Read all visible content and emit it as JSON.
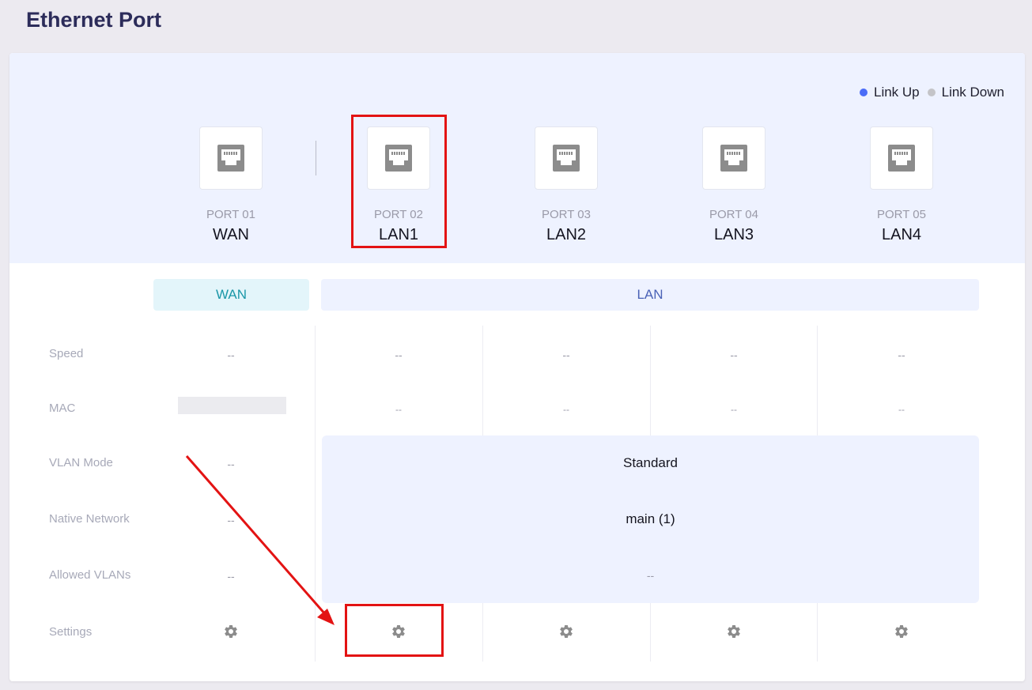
{
  "page": {
    "title": "Ethernet Port"
  },
  "legend": {
    "link_up": "Link Up",
    "link_down": "Link Down",
    "link_up_color": "#4a6cf7",
    "link_down_color": "#c4c4c8"
  },
  "ports": [
    {
      "num": "PORT 01",
      "name": "WAN"
    },
    {
      "num": "PORT 02",
      "name": "LAN1"
    },
    {
      "num": "PORT 03",
      "name": "LAN2"
    },
    {
      "num": "PORT 04",
      "name": "LAN3"
    },
    {
      "num": "PORT 05",
      "name": "LAN4"
    }
  ],
  "groups": {
    "wan": "WAN",
    "lan": "LAN"
  },
  "rows": {
    "speed": "Speed",
    "mac": "MAC",
    "vlan_mode": "VLAN Mode",
    "native_network": "Native Network",
    "allowed_vlans": "Allowed VLANs",
    "settings": "Settings"
  },
  "wan": {
    "speed": "--",
    "vlan_mode": "--",
    "native_network": "--",
    "allowed_vlans": "--"
  },
  "lan": {
    "speed": [
      "--",
      "--",
      "--",
      "--"
    ],
    "mac": [
      "--",
      "--",
      "--",
      "--"
    ],
    "vlan_mode": "Standard",
    "native_network": "main (1)",
    "allowed_vlans": "--"
  },
  "icons": {
    "port": "ethernet-port-icon",
    "settings": "gear-icon"
  },
  "colors": {
    "annotation": "#e31313",
    "icon": "#8c8c8c"
  }
}
